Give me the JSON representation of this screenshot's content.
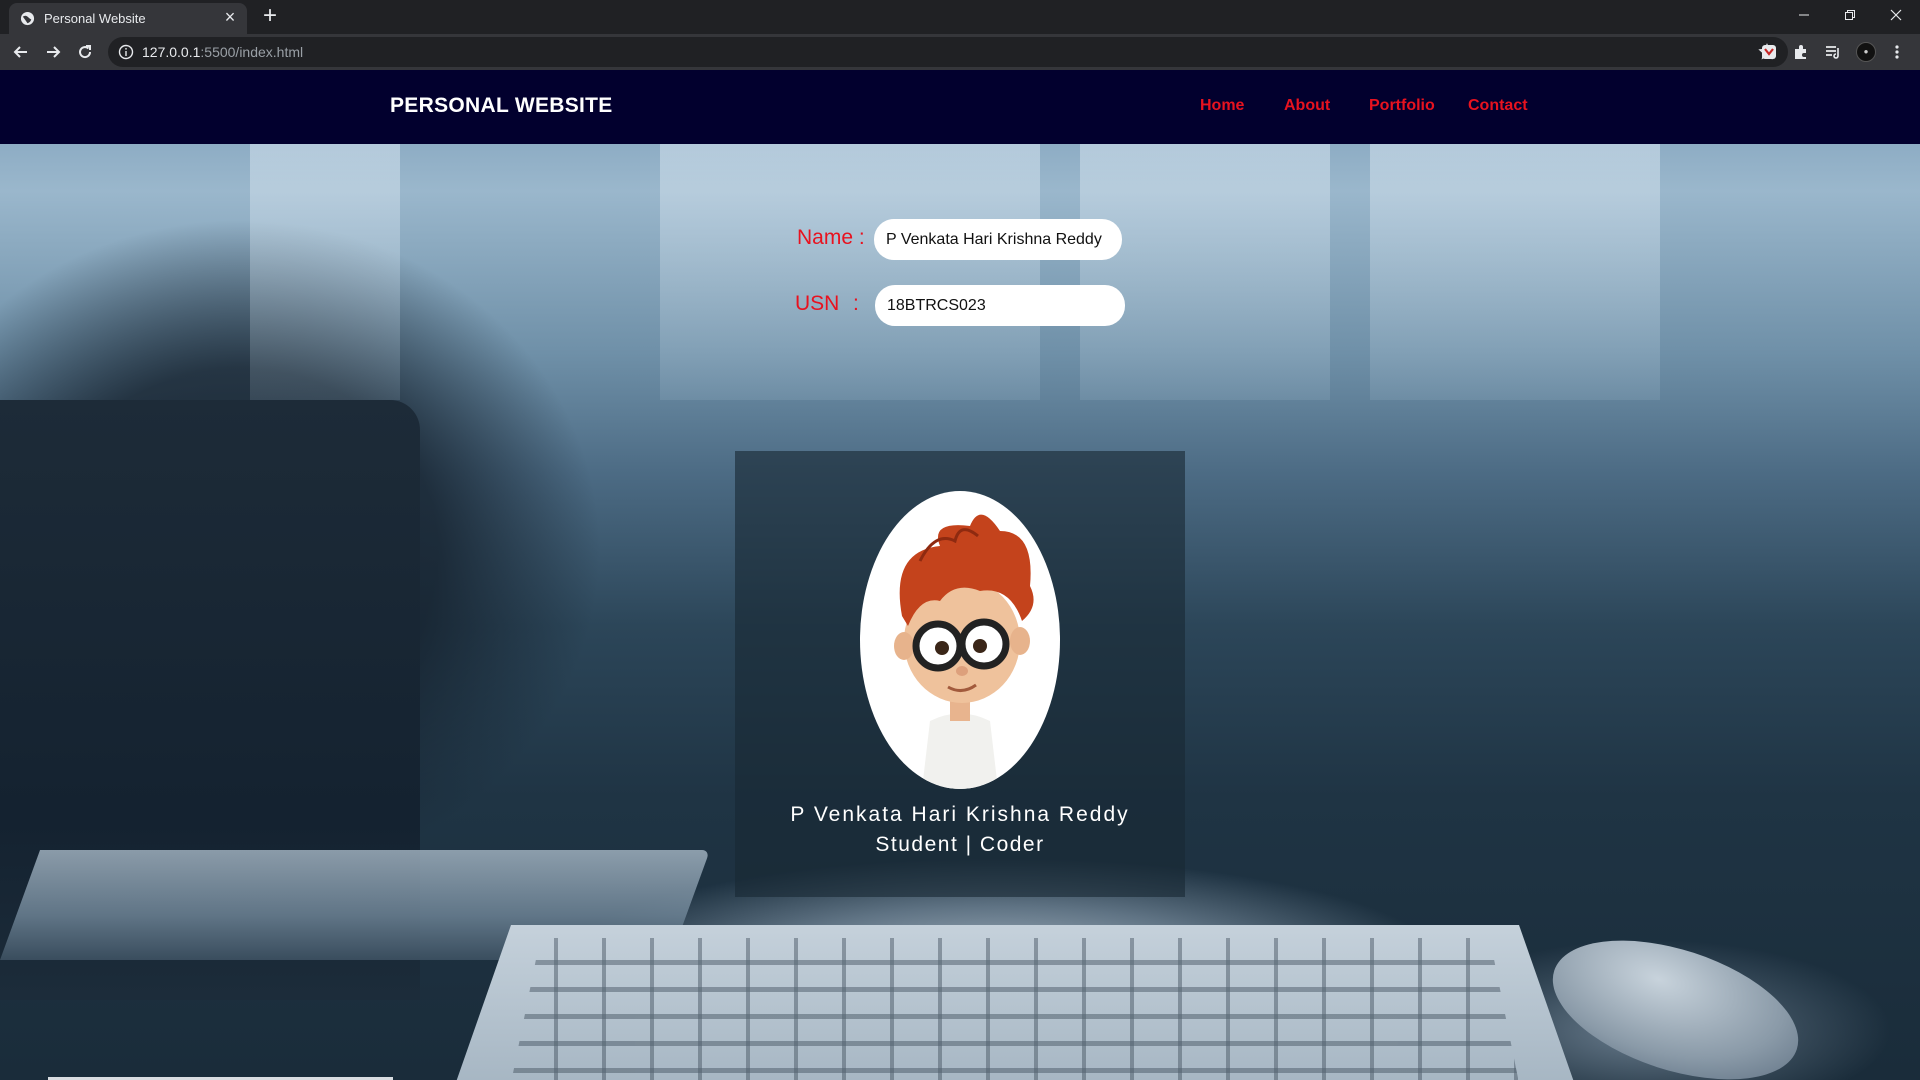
{
  "browser": {
    "tab_title": "Personal Website",
    "url_host": "127.0.0.1",
    "url_rest": ":5500/index.html",
    "icons": [
      "globe-icon",
      "close-icon",
      "plus-icon",
      "minimize-icon",
      "restore-icon",
      "window-close-icon",
      "back-arrow-icon",
      "forward-arrow-icon",
      "reload-icon",
      "info-icon",
      "star-icon",
      "extension-icon",
      "puzzle-icon",
      "playlist-icon",
      "kebab-menu-icon"
    ]
  },
  "site": {
    "brand": "PERSONAL WEBSITE",
    "nav": [
      "Home",
      "About",
      "Portfolio",
      "Contact"
    ],
    "accent_color": "#e8121f",
    "nav_bg": "#02002e"
  },
  "form": {
    "name_label": "Name :",
    "name_value": "P Venkata Hari Krishna Reddy",
    "usn_label": "USN",
    "usn_colon": ":",
    "usn_value": "18BTRCS023"
  },
  "card": {
    "name": "P Venkata Hari Krishna Reddy",
    "role": "Student | Coder"
  }
}
